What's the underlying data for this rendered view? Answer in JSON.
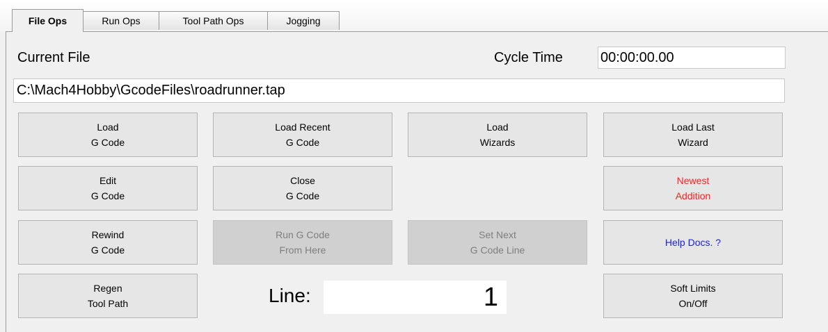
{
  "tabs": [
    {
      "label": "File Ops",
      "active": true
    },
    {
      "label": "Run Ops",
      "active": false
    },
    {
      "label": "Tool Path Ops",
      "active": false
    },
    {
      "label": "Jogging",
      "active": false
    }
  ],
  "current_file": {
    "label": "Current File",
    "path": "C:\\Mach4Hobby\\GcodeFiles\\roadrunner.tap"
  },
  "cycle_time": {
    "label": "Cycle Time",
    "value": "00:00:00.00"
  },
  "buttons": {
    "load_gcode": {
      "line1": "Load",
      "line2": "G Code",
      "enabled": true
    },
    "load_recent": {
      "line1": "Load Recent",
      "line2": "G Code",
      "enabled": true
    },
    "load_wizards": {
      "line1": "Load",
      "line2": "Wizards",
      "enabled": true
    },
    "load_last_wizard": {
      "line1": "Load Last",
      "line2": "Wizard",
      "enabled": true
    },
    "edit_gcode": {
      "line1": "Edit",
      "line2": "G Code",
      "enabled": true
    },
    "close_gcode": {
      "line1": "Close",
      "line2": "G Code",
      "enabled": true
    },
    "newest_addition": {
      "line1": "Newest",
      "line2": "Addition",
      "enabled": true,
      "color": "#ff2020"
    },
    "rewind_gcode": {
      "line1": "Rewind",
      "line2": "G Code",
      "enabled": true
    },
    "run_from_here": {
      "line1": "Run G Code",
      "line2": "From Here",
      "enabled": false
    },
    "set_next_line": {
      "line1": "Set Next",
      "line2": "G Code Line",
      "enabled": false
    },
    "help_docs": {
      "line1": "Help Docs. ?",
      "enabled": true,
      "color": "#1a1aff"
    },
    "regen_toolpath": {
      "line1": "Regen",
      "line2": "Tool Path",
      "enabled": true
    },
    "soft_limits": {
      "line1": "Soft Limits",
      "line2": "On/Off",
      "enabled": true
    }
  },
  "line": {
    "label": "Line:",
    "value": "1"
  }
}
